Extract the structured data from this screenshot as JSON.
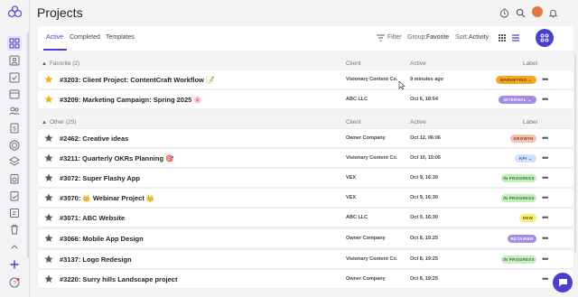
{
  "header": {
    "title": "Projects"
  },
  "toolbar": {
    "tabs": [
      {
        "label": "Active"
      },
      {
        "label": "Completed"
      },
      {
        "label": "Templates"
      }
    ],
    "filter_label": "Filter",
    "group_label": "Group:",
    "group_value": "Favorite",
    "sort_label": "Sort:",
    "sort_value": "Activity"
  },
  "columns": {
    "client": "Client",
    "active": "Active",
    "label": "Label"
  },
  "groups": [
    {
      "title": "Favorite (2)",
      "rows": [
        {
          "name": "#3203: Client Project: ContentCraft Workflow 📝",
          "client": "Visionary Content Co.",
          "active": "9 minutes ago",
          "label": "MARKETING",
          "starred": true
        },
        {
          "name": "#3209: Marketing Campaign: Spring 2025 🌸",
          "client": "ABC LLC",
          "active": "Oct 6, 18:54",
          "label": "INTERNAL",
          "starred": true
        }
      ]
    },
    {
      "title": "Other (25)",
      "rows": [
        {
          "name": "#2462: Creative ideas",
          "client": "Owner Company",
          "active": "Oct 12, 06:06",
          "label": "GROWTH",
          "starred": false
        },
        {
          "name": "#3211: Quarterly OKRs Planning 🎯",
          "client": "Visionary Content Co.",
          "active": "Oct 10, 15:05",
          "label": "KPI",
          "starred": false
        },
        {
          "name": "#3072: Super Flashy App",
          "client": "VEX",
          "active": "Oct 9, 16:30",
          "label": "IN PROGRESS",
          "starred": false
        },
        {
          "name": "#3070: 👑 Webinar Project 👑",
          "client": "VEX",
          "active": "Oct 9, 16:30",
          "label": "IN PROGRESS",
          "starred": false
        },
        {
          "name": "#3071: ABC Website",
          "client": "ABC LLC",
          "active": "Oct 9, 16:30",
          "label": "NEW",
          "starred": false
        },
        {
          "name": "#3066: Mobile App Design",
          "client": "Owner Company",
          "active": "Oct 8, 19:25",
          "label": "RETAINER",
          "starred": false
        },
        {
          "name": "#3137: Logo Redesign",
          "client": "Visionary Content Co.",
          "active": "Oct 8, 19:25",
          "label": "IN PROGRESS",
          "starred": false
        },
        {
          "name": "#3220: Surry hills Landscape project",
          "client": "Owner Company",
          "active": "Oct 8, 19:25",
          "label": "",
          "starred": false
        }
      ]
    }
  ],
  "colors": {
    "accent": "#4a3fcf",
    "star_fav": "#f2b41c",
    "star_other": "#5a5a64",
    "badge_marketing": "#f6a623",
    "badge_internal": "#a58be8",
    "badge_growth": "#f3c3b0",
    "badge_kpi": "#cfe0fb",
    "badge_inprogress": "#c8ebc2",
    "badge_new": "#fbeb7a",
    "badge_retainer": "#a58be8"
  }
}
